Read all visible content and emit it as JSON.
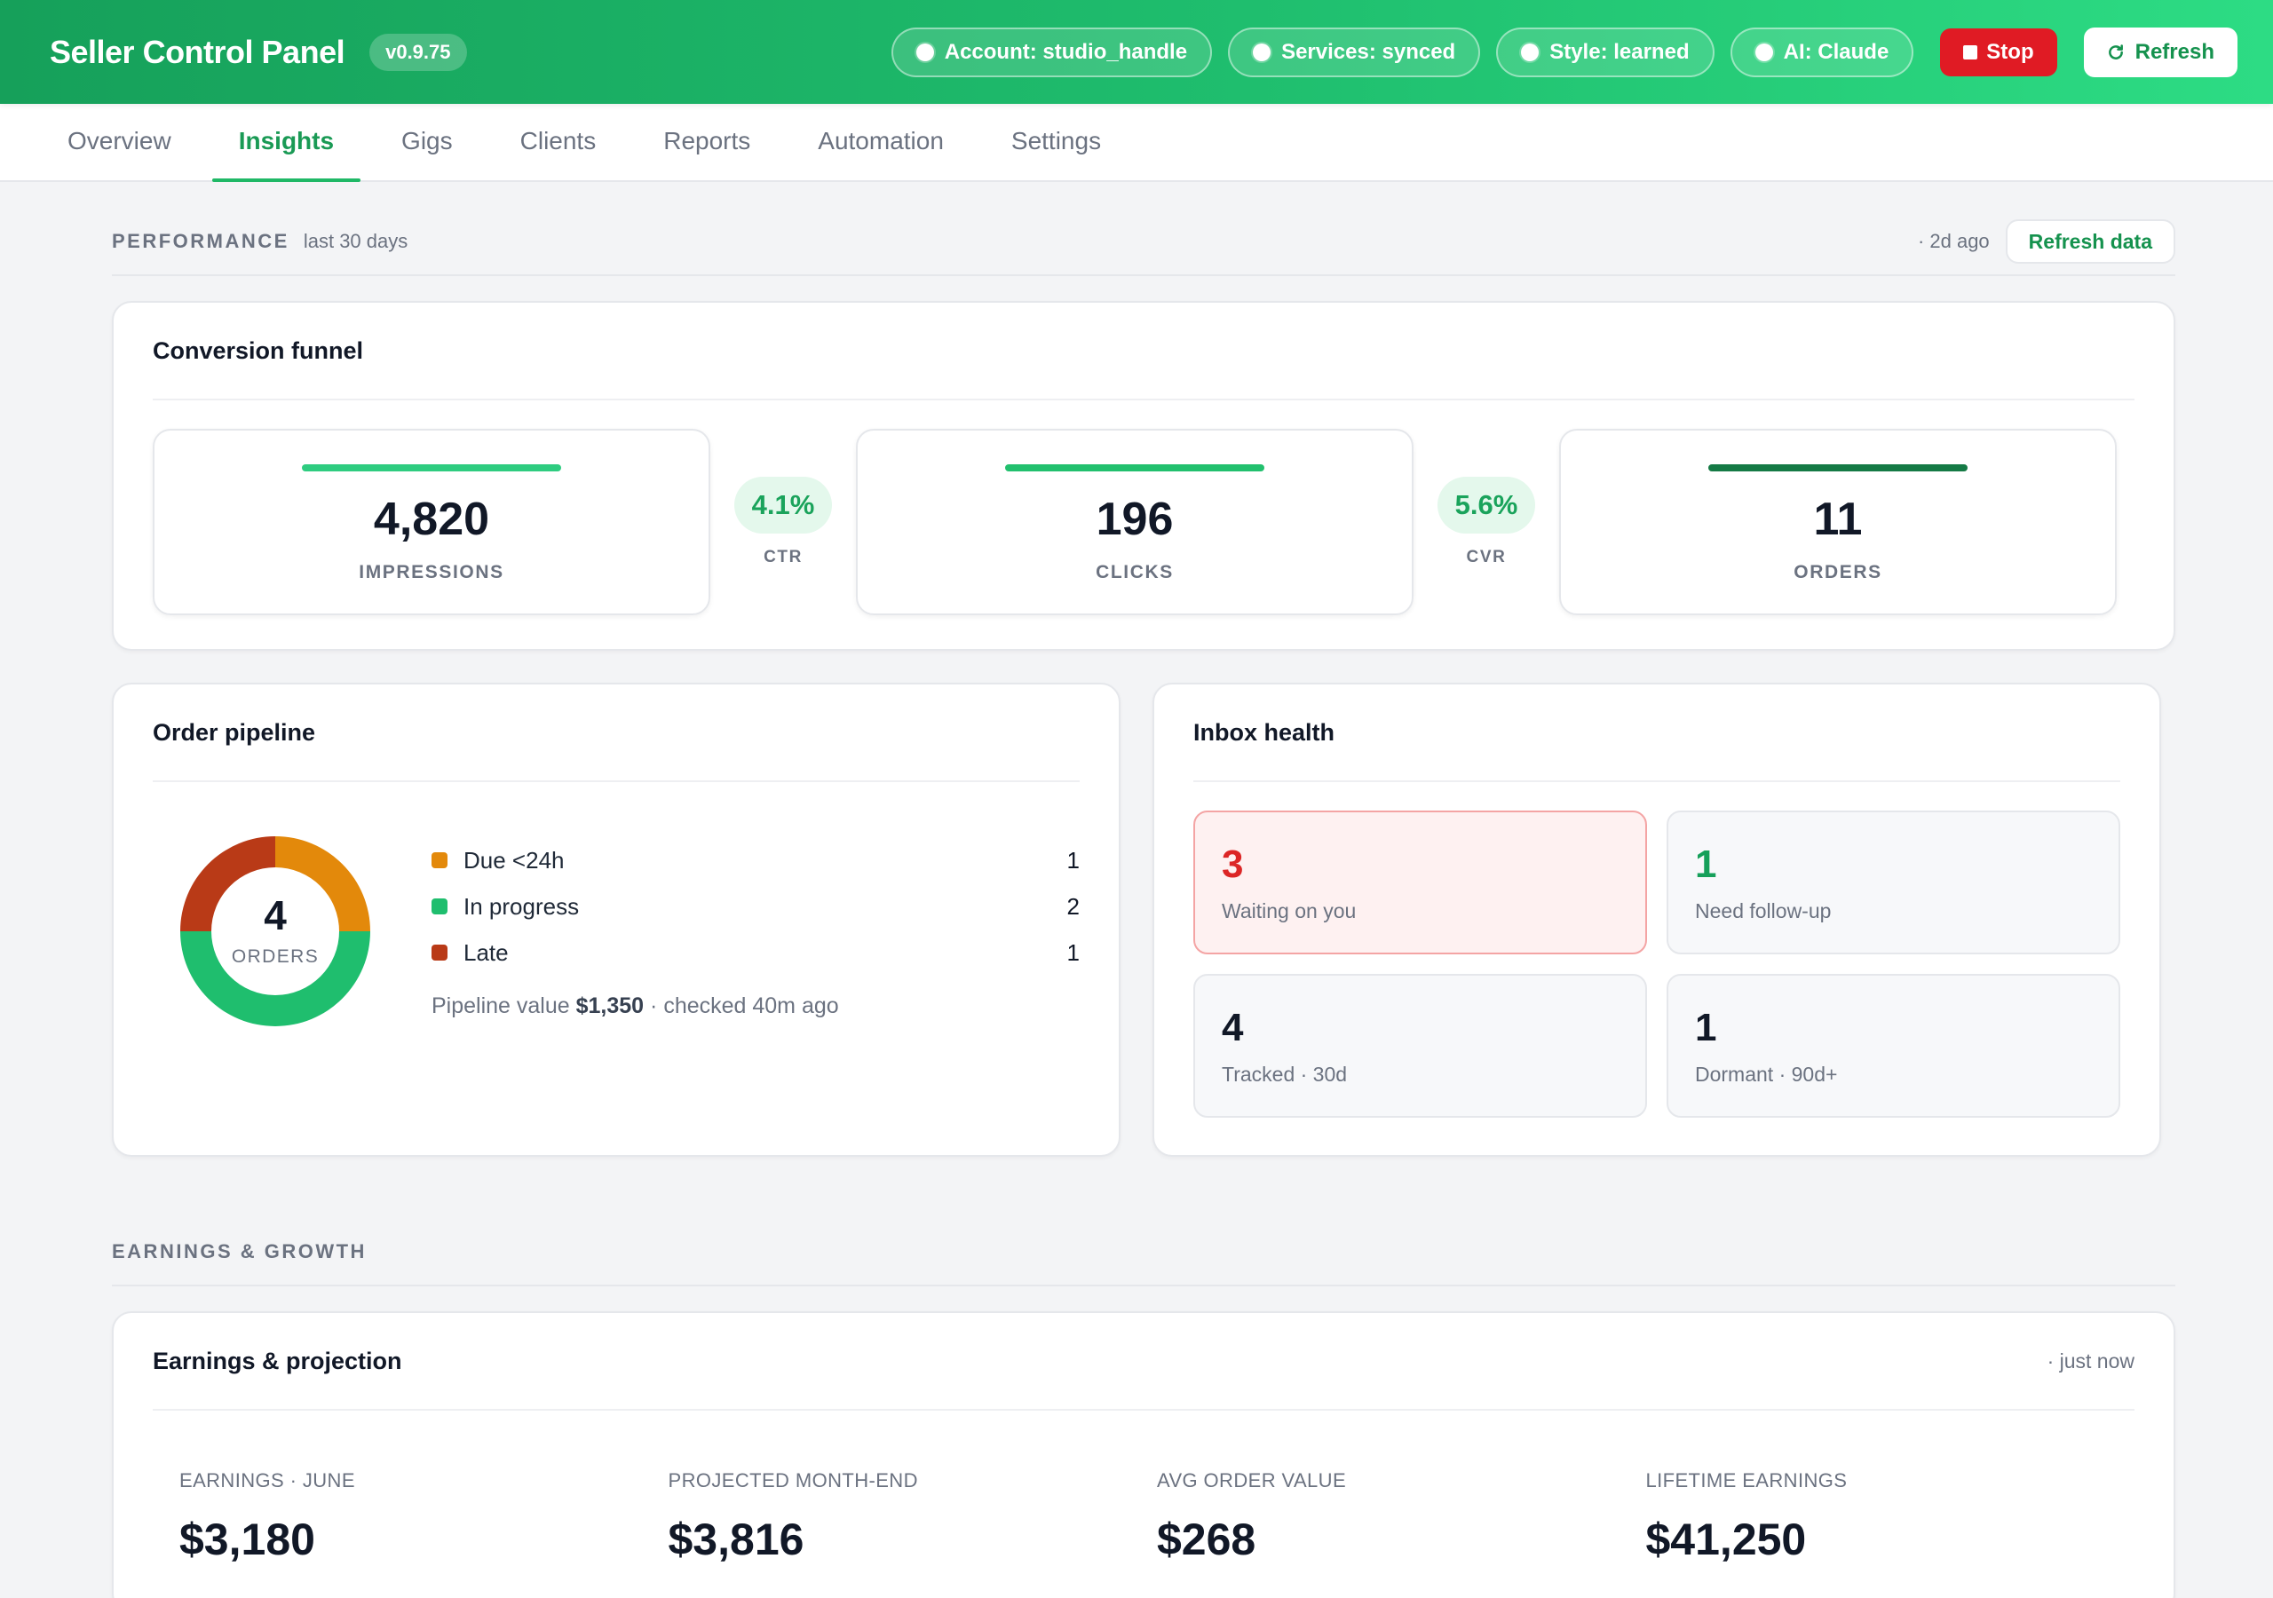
{
  "header": {
    "brand": "Seller Control Panel",
    "version": "v0.9.75",
    "pills": [
      {
        "label": "Account: studio_handle"
      },
      {
        "label": "Services: synced"
      },
      {
        "label": "Style: learned"
      },
      {
        "label": "AI: Claude"
      }
    ],
    "stop_label": "Stop",
    "refresh_label": "Refresh"
  },
  "tabs": [
    {
      "label": "Overview"
    },
    {
      "label": "Insights",
      "active": true
    },
    {
      "label": "Gigs"
    },
    {
      "label": "Clients"
    },
    {
      "label": "Reports"
    },
    {
      "label": "Automation"
    },
    {
      "label": "Settings"
    }
  ],
  "performance": {
    "title": "PERFORMANCE",
    "subtitle": "last 30 days",
    "updated": "· 2d ago",
    "refresh_label": "Refresh data"
  },
  "funnel": {
    "title": "Conversion funnel",
    "stages": [
      {
        "value": "4,820",
        "label": "IMPRESSIONS",
        "color": "#2ecc80"
      },
      {
        "value": "196",
        "label": "CLICKS",
        "color": "#22c06e"
      },
      {
        "value": "11",
        "label": "ORDERS",
        "color": "#157a45"
      }
    ],
    "rates": [
      {
        "value": "4.1%",
        "label": "CTR"
      },
      {
        "value": "5.6%",
        "label": "CVR"
      }
    ]
  },
  "pipeline": {
    "title": "Order pipeline",
    "total": "4",
    "total_label": "ORDERS",
    "segments": [
      {
        "label": "Due <24h",
        "count": "1",
        "color": "#e3890b"
      },
      {
        "label": "In progress",
        "count": "2",
        "color": "#1fbe6e"
      },
      {
        "label": "Late",
        "count": "1",
        "color": "#b93a17"
      }
    ],
    "note_prefix": "Pipeline value",
    "note_value": "$1,350",
    "note_suffix": "· checked 40m ago"
  },
  "inbox": {
    "title": "Inbox health",
    "tiles": [
      {
        "value": "3",
        "label": "Waiting on you"
      },
      {
        "value": "1",
        "label": "Need follow-up"
      },
      {
        "value": "4",
        "label": "Tracked · 30d"
      },
      {
        "value": "1",
        "label": "Dormant · 90d+"
      }
    ]
  },
  "earnings_section": {
    "title": "EARNINGS & GROWTH"
  },
  "earnings": {
    "title": "Earnings & projection",
    "updated": "· just now",
    "metrics": [
      {
        "label": "EARNINGS · JUNE",
        "value": "$3,180"
      },
      {
        "label": "PROJECTED MONTH-END",
        "value": "$3,816"
      },
      {
        "label": "AVG ORDER VALUE",
        "value": "$268"
      },
      {
        "label": "LIFETIME EARNINGS",
        "value": "$41,250"
      }
    ]
  }
}
